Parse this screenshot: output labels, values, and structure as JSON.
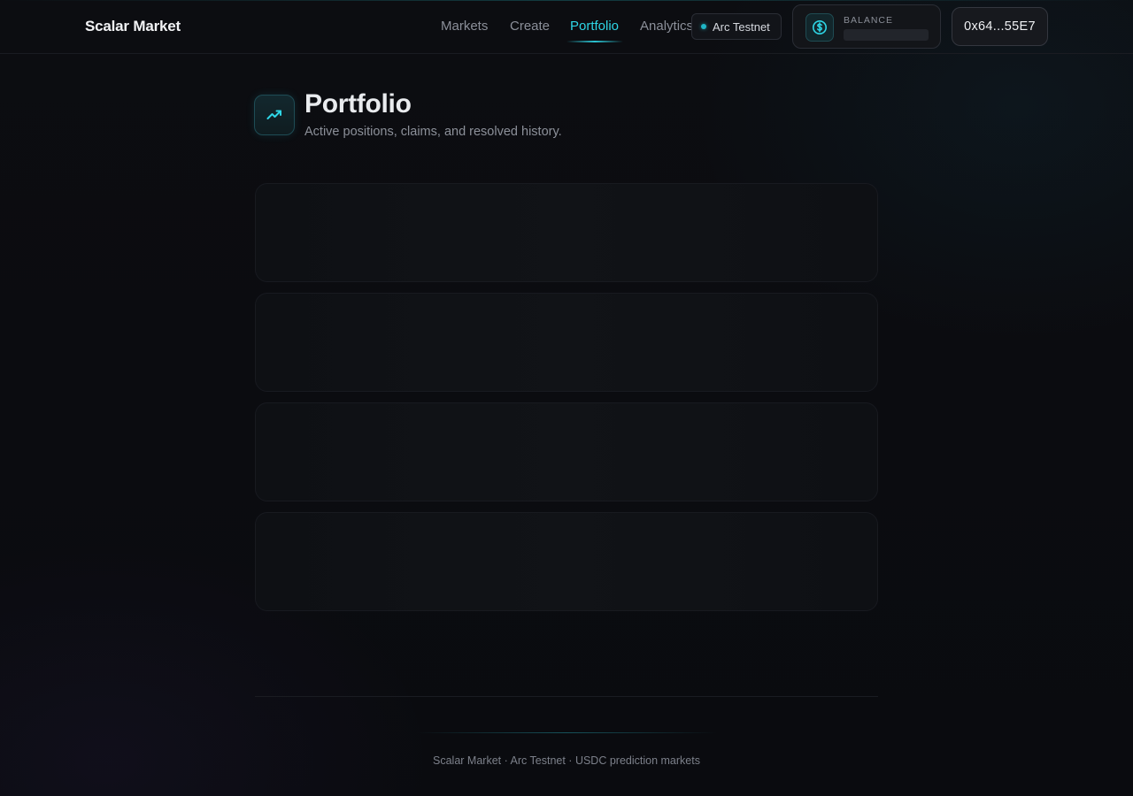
{
  "header": {
    "brand": "Scalar Market",
    "nav": [
      {
        "label": "Markets",
        "active": false
      },
      {
        "label": "Create",
        "active": false
      },
      {
        "label": "Portfolio",
        "active": true
      },
      {
        "label": "Analytics",
        "active": false
      }
    ],
    "network": "Arc Testnet",
    "balance_label": "BALANCE",
    "wallet": "0x64...55E7"
  },
  "page": {
    "title": "Portfolio",
    "subtitle": "Active positions, claims, and resolved history."
  },
  "footer": {
    "text": "Scalar Market · Arc Testnet · USDC prediction markets"
  },
  "colors": {
    "accent": "#2ed6e6",
    "background": "#0b0c10"
  },
  "icons": {
    "page": "trending-up-icon",
    "balance": "dollar-coin-icon",
    "network": "status-dot-icon"
  }
}
